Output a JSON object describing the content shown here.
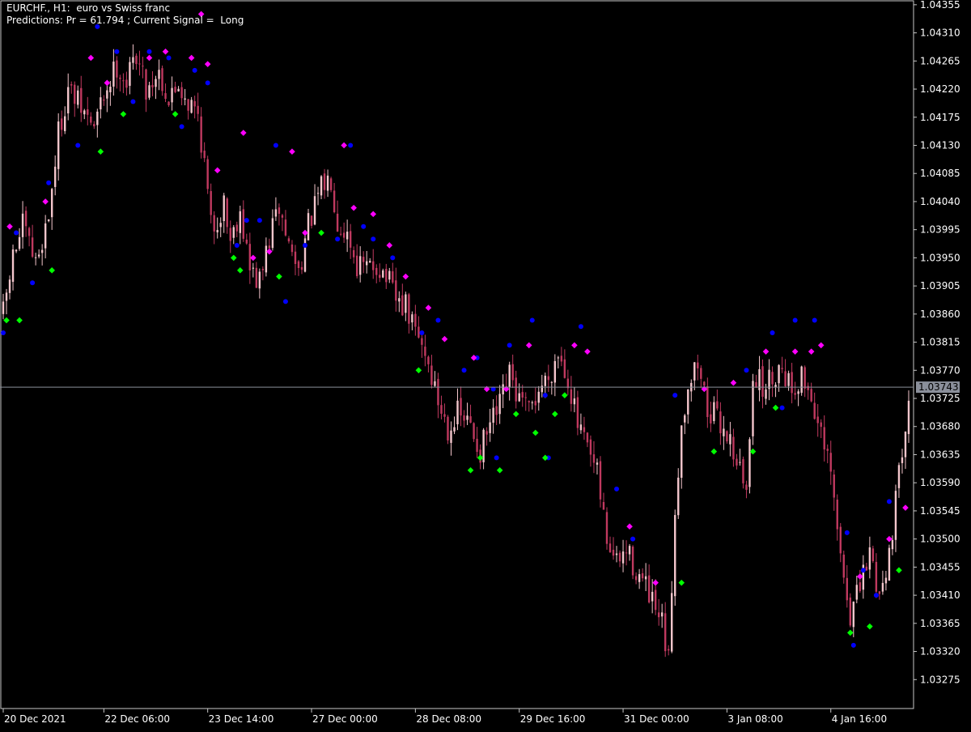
{
  "header": {
    "line1": "EURCHF., H1:  euro vs Swiss franc",
    "line2": "Predictions: Pr = 61.794 ; Current Signal =  Long"
  },
  "colors": {
    "background": "#000000",
    "frame": "#c8c8c8",
    "candle_bull": "#f4c6cc",
    "candle_bear": "#c0395f",
    "dot_blue": "#0000ff",
    "diamond_magenta": "#ff00ff",
    "diamond_green": "#00ff00",
    "price_line": "#8a8f9a",
    "price_label_bg": "#8a8f9a",
    "price_label_text": "#000000"
  },
  "chart_data": {
    "type": "candlestick",
    "symbol": "EURCHF.",
    "timeframe": "H1",
    "ylim": [
      1.0323,
      1.0436
    ],
    "current_price": 1.03743,
    "current_price_label": "1.03743",
    "y_ticks": [
      "1.04355",
      "1.04310",
      "1.04265",
      "1.04220",
      "1.04175",
      "1.04130",
      "1.04085",
      "1.04040",
      "1.03995",
      "1.03950",
      "1.03905",
      "1.03860",
      "1.03815",
      "1.03770",
      "1.03725",
      "1.03680",
      "1.03635",
      "1.03590",
      "1.03545",
      "1.03500",
      "1.03455",
      "1.03410",
      "1.03365",
      "1.03320",
      "1.03275"
    ],
    "x_ticks": [
      {
        "label": "20 Dec 2021",
        "bar": 0
      },
      {
        "label": "22 Dec 06:00",
        "bar": 31
      },
      {
        "label": "23 Dec 14:00",
        "bar": 63
      },
      {
        "label": "27 Dec 00:00",
        "bar": 95
      },
      {
        "label": "28 Dec 08:00",
        "bar": 127
      },
      {
        "label": "29 Dec 16:00",
        "bar": 159
      },
      {
        "label": "31 Dec 00:00",
        "bar": 191
      },
      {
        "label": "3 Jan 08:00",
        "bar": 223
      },
      {
        "label": "4 Jan 16:00",
        "bar": 255
      }
    ],
    "bars_count": 280,
    "close_path": [
      [
        0,
        1.0386
      ],
      [
        3,
        1.0395
      ],
      [
        6,
        1.04
      ],
      [
        10,
        1.0394
      ],
      [
        14,
        1.0402
      ],
      [
        17,
        1.0415
      ],
      [
        20,
        1.0422
      ],
      [
        25,
        1.0418
      ],
      [
        28,
        1.0416
      ],
      [
        31,
        1.0421
      ],
      [
        35,
        1.0426
      ],
      [
        38,
        1.0423
      ],
      [
        41,
        1.0428
      ],
      [
        44,
        1.0422
      ],
      [
        48,
        1.0425
      ],
      [
        51,
        1.042
      ],
      [
        54,
        1.0423
      ],
      [
        57,
        1.042
      ],
      [
        60,
        1.0418
      ],
      [
        62,
        1.041
      ],
      [
        64,
        1.04
      ],
      [
        66,
        1.0401
      ],
      [
        68,
        1.0404
      ],
      [
        70,
        1.0398
      ],
      [
        73,
        1.0403
      ],
      [
        76,
        1.0393
      ],
      [
        79,
        1.0391
      ],
      [
        82,
        1.0398
      ],
      [
        85,
        1.0403
      ],
      [
        88,
        1.0397
      ],
      [
        91,
        1.0393
      ],
      [
        94,
        1.04
      ],
      [
        98,
        1.0406
      ],
      [
        101,
        1.0408
      ],
      [
        103,
        1.0401
      ],
      [
        106,
        1.0399
      ],
      [
        109,
        1.0394
      ],
      [
        112,
        1.0393
      ],
      [
        115,
        1.0394
      ],
      [
        118,
        1.0392
      ],
      [
        121,
        1.0388
      ],
      [
        124,
        1.0387
      ],
      [
        127,
        1.0383
      ],
      [
        130,
        1.038
      ],
      [
        134,
        1.0372
      ],
      [
        137,
        1.0368
      ],
      [
        140,
        1.037
      ],
      [
        144,
        1.0368
      ],
      [
        147,
        1.0364
      ],
      [
        150,
        1.0368
      ],
      [
        153,
        1.0371
      ],
      [
        156,
        1.0376
      ],
      [
        159,
        1.0372
      ],
      [
        162,
        1.037
      ],
      [
        165,
        1.0374
      ],
      [
        168,
        1.0376
      ],
      [
        171,
        1.038
      ],
      [
        174,
        1.0376
      ],
      [
        177,
        1.0368
      ],
      [
        180,
        1.0364
      ],
      [
        183,
        1.036
      ],
      [
        186,
        1.035
      ],
      [
        189,
        1.0346
      ],
      [
        192,
        1.0348
      ],
      [
        195,
        1.0345
      ],
      [
        198,
        1.0342
      ],
      [
        201,
        1.0338
      ],
      [
        203,
        1.0336
      ],
      [
        205,
        1.033
      ],
      [
        207,
        1.0355
      ],
      [
        209,
        1.0368
      ],
      [
        211,
        1.0375
      ],
      [
        214,
        1.0378
      ],
      [
        217,
        1.0371
      ],
      [
        220,
        1.0369
      ],
      [
        223,
        1.0367
      ],
      [
        226,
        1.0363
      ],
      [
        229,
        1.0357
      ],
      [
        231,
        1.0377
      ],
      [
        234,
        1.0374
      ],
      [
        237,
        1.0376
      ],
      [
        240,
        1.0378
      ],
      [
        243,
        1.0374
      ],
      [
        246,
        1.0376
      ],
      [
        249,
        1.0373
      ],
      [
        252,
        1.0366
      ],
      [
        255,
        1.036
      ],
      [
        258,
        1.0347
      ],
      [
        261,
        1.0338
      ],
      [
        264,
        1.0342
      ],
      [
        267,
        1.0348
      ],
      [
        270,
        1.0341
      ],
      [
        273,
        1.0348
      ],
      [
        276,
        1.036
      ],
      [
        279,
        1.0374
      ]
    ],
    "series": [
      {
        "marker": "blue-dot",
        "points": [
          [
            0,
            1.0383
          ],
          [
            4,
            1.0399
          ],
          [
            9,
            1.0391
          ],
          [
            14,
            1.0407
          ],
          [
            23,
            1.0413
          ],
          [
            29,
            1.0432
          ],
          [
            35,
            1.0428
          ],
          [
            40,
            1.042
          ],
          [
            45,
            1.0428
          ],
          [
            51,
            1.0427
          ],
          [
            55,
            1.0416
          ],
          [
            59,
            1.0425
          ],
          [
            63,
            1.0423
          ],
          [
            72,
            1.0397
          ],
          [
            75,
            1.0401
          ],
          [
            79,
            1.0401
          ],
          [
            84,
            1.0413
          ],
          [
            87,
            1.0388
          ],
          [
            93,
            1.0397
          ],
          [
            103,
            1.0398
          ],
          [
            107,
            1.0413
          ],
          [
            111,
            1.04
          ],
          [
            114,
            1.0398
          ],
          [
            120,
            1.0395
          ],
          [
            129,
            1.0383
          ],
          [
            134,
            1.0385
          ],
          [
            142,
            1.0377
          ],
          [
            146,
            1.0379
          ],
          [
            151,
            1.0374
          ],
          [
            152,
            1.0363
          ],
          [
            156,
            1.0381
          ],
          [
            163,
            1.0385
          ],
          [
            167,
            1.0373
          ],
          [
            168,
            1.0363
          ],
          [
            178,
            1.0384
          ],
          [
            189,
            1.0358
          ],
          [
            194,
            1.035
          ],
          [
            207,
            1.0373
          ],
          [
            229,
            1.0377
          ],
          [
            237,
            1.0383
          ],
          [
            240,
            1.0371
          ],
          [
            244,
            1.0385
          ],
          [
            250,
            1.0385
          ],
          [
            260,
            1.0351
          ],
          [
            262,
            1.0333
          ],
          [
            265,
            1.0345
          ],
          [
            269,
            1.0341
          ],
          [
            273,
            1.0356
          ]
        ]
      },
      {
        "marker": "magenta-diamond",
        "points": [
          [
            2,
            1.04
          ],
          [
            13,
            1.0404
          ],
          [
            27,
            1.0427
          ],
          [
            32,
            1.0423
          ],
          [
            45,
            1.0427
          ],
          [
            50,
            1.0428
          ],
          [
            61,
            1.0434
          ],
          [
            58,
            1.0427
          ],
          [
            63,
            1.0426
          ],
          [
            66,
            1.0409
          ],
          [
            74,
            1.0415
          ],
          [
            77,
            1.0395
          ],
          [
            82,
            1.0396
          ],
          [
            89,
            1.0412
          ],
          [
            93,
            1.0399
          ],
          [
            105,
            1.0413
          ],
          [
            108,
            1.0403
          ],
          [
            114,
            1.0402
          ],
          [
            119,
            1.0397
          ],
          [
            124,
            1.0392
          ],
          [
            131,
            1.0387
          ],
          [
            136,
            1.0382
          ],
          [
            145,
            1.0379
          ],
          [
            149,
            1.0374
          ],
          [
            155,
            1.0374
          ],
          [
            162,
            1.0381
          ],
          [
            176,
            1.0381
          ],
          [
            180,
            1.038
          ],
          [
            193,
            1.0352
          ],
          [
            201,
            1.0343
          ],
          [
            216,
            1.0374
          ],
          [
            225,
            1.0375
          ],
          [
            235,
            1.038
          ],
          [
            244,
            1.038
          ],
          [
            249,
            1.038
          ],
          [
            252,
            1.0381
          ],
          [
            264,
            1.0344
          ],
          [
            273,
            1.035
          ],
          [
            278,
            1.0355
          ]
        ]
      },
      {
        "marker": "green-diamond",
        "points": [
          [
            1,
            1.0385
          ],
          [
            5,
            1.0385
          ],
          [
            15,
            1.0393
          ],
          [
            30,
            1.0412
          ],
          [
            37,
            1.0418
          ],
          [
            53,
            1.0418
          ],
          [
            71,
            1.0395
          ],
          [
            73,
            1.0393
          ],
          [
            85,
            1.0392
          ],
          [
            98,
            1.0399
          ],
          [
            128,
            1.0377
          ],
          [
            144,
            1.0361
          ],
          [
            147,
            1.0363
          ],
          [
            153,
            1.0361
          ],
          [
            158,
            1.037
          ],
          [
            164,
            1.0367
          ],
          [
            167,
            1.0363
          ],
          [
            170,
            1.037
          ],
          [
            173,
            1.0373
          ],
          [
            209,
            1.0343
          ],
          [
            219,
            1.0364
          ],
          [
            231,
            1.0364
          ],
          [
            238,
            1.0371
          ],
          [
            261,
            1.0335
          ],
          [
            267,
            1.0336
          ],
          [
            276,
            1.0345
          ]
        ]
      }
    ],
    "grid": false,
    "legend": "none"
  }
}
